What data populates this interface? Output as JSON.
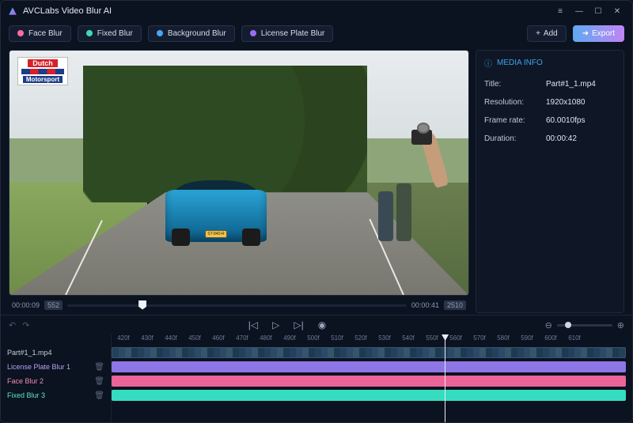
{
  "app": {
    "title": "AVCLabs Video Blur AI"
  },
  "toolbar": {
    "face": "Face Blur",
    "fixed": "Fixed Blur",
    "background": "Background Blur",
    "license": "License Plate Blur",
    "add": "Add",
    "export": "Export",
    "colors": {
      "face": "#ff6aa3",
      "fixed": "#3dd8bc",
      "background": "#4aa4f2",
      "license": "#9a6df2"
    }
  },
  "preview": {
    "logo_top": "Dutch",
    "logo_bottom": "Motorsport",
    "plate": "ST-840-R"
  },
  "scrub": {
    "cur_time": "00:00:09",
    "cur_frame": "552",
    "end_time": "00:00:41",
    "end_frame": "2510"
  },
  "media_info": {
    "heading": "MEDIA INFO",
    "title_k": "Title:",
    "title_v": "Part#1_1.mp4",
    "res_k": "Resolution:",
    "res_v": "1920x1080",
    "fps_k": "Frame rate:",
    "fps_v": "60.0010fps",
    "dur_k": "Duration:",
    "dur_v": "00:00:42"
  },
  "timeline": {
    "ruler": [
      "420f",
      "430f",
      "440f",
      "450f",
      "460f",
      "470f",
      "480f",
      "490f",
      "500f",
      "510f",
      "520f",
      "530f",
      "540f",
      "550f",
      "560f",
      "570f",
      "580f",
      "590f",
      "600f",
      "610f"
    ],
    "tracks": {
      "video": "Part#1_1.mp4",
      "lp": "License Plate Blur 1",
      "face": "Face Blur 2",
      "fixed": "Fixed Blur 3"
    }
  }
}
